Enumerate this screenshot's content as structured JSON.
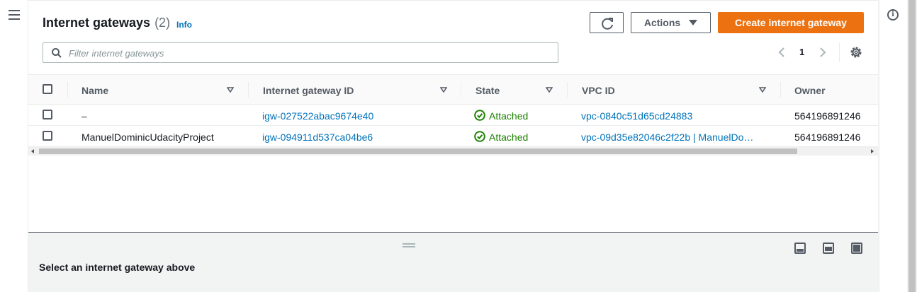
{
  "header": {
    "title": "Internet gateways",
    "count": "(2)",
    "info_label": "Info",
    "actions_label": "Actions",
    "create_label": "Create internet gateway"
  },
  "search": {
    "placeholder": "Filter internet gateways",
    "value": ""
  },
  "pagination": {
    "current_page": "1"
  },
  "table": {
    "columns": [
      "Name",
      "Internet gateway ID",
      "State",
      "VPC ID",
      "Owner"
    ],
    "rows": [
      {
        "name": "–",
        "gateway_id": "igw-027522abac9674e40",
        "state": "Attached",
        "vpc_id": "vpc-0840c51d65cd24883",
        "owner": "564196891246"
      },
      {
        "name": "ManuelDominicUdacityProject",
        "gateway_id": "igw-094911d537ca04be6",
        "state": "Attached",
        "vpc_id": "vpc-09d35e82046c2f22b | ManuelDo…",
        "owner": "564196891246"
      }
    ]
  },
  "split_panel": {
    "message": "Select an internet gateway above"
  },
  "colors": {
    "accent": "#ec7211",
    "link": "#0073bb",
    "success": "#1d8102"
  },
  "icons": [
    "menu-icon",
    "info-circle-icon",
    "refresh-icon",
    "caret-down-icon",
    "search-icon",
    "chevron-left-icon",
    "chevron-right-icon",
    "settings-icon",
    "sort-icon",
    "check-circle-icon",
    "split-bottom-icon",
    "split-side-icon",
    "split-off-icon",
    "drag-handle-icon"
  ]
}
